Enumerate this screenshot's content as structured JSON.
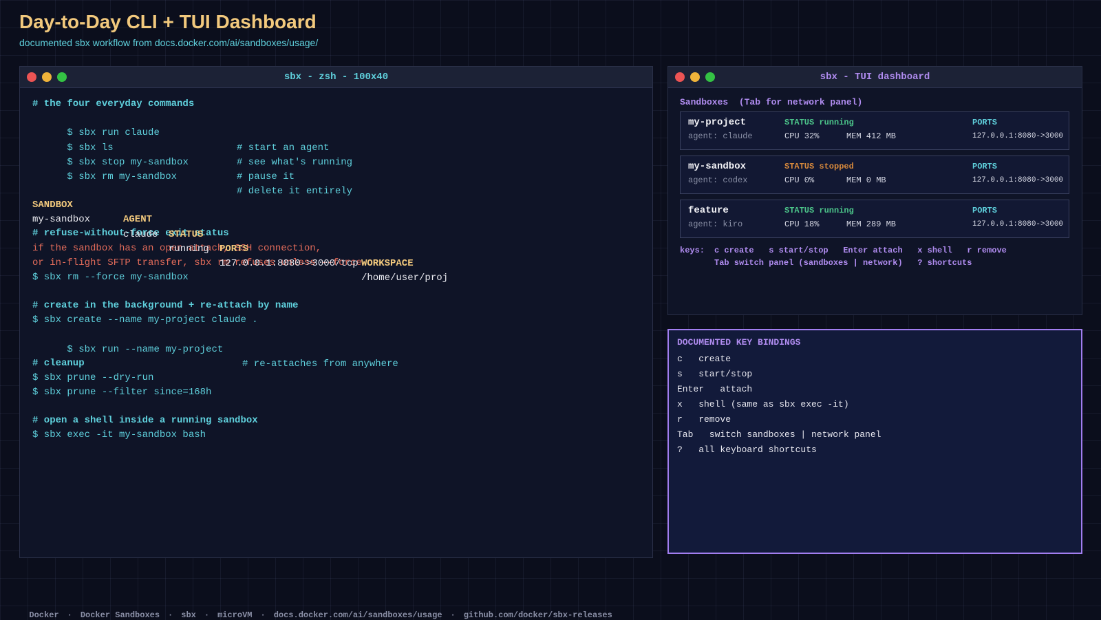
{
  "page": {
    "title": "Day-to-Day CLI + TUI Dashboard",
    "subtitle": "documented sbx workflow from docs.docker.com/ai/sandboxes/usage/"
  },
  "terminal": {
    "title": "sbx  -  zsh  -  100x40",
    "sections": {
      "everyday_comment": "# the four everyday commands",
      "everyday": [
        {
          "cmd": "$ sbx run claude",
          "comment": "# start an agent"
        },
        {
          "cmd": "$ sbx ls",
          "comment": "# see what's running"
        },
        {
          "cmd": "$ sbx stop my-sandbox",
          "comment": "# pause it"
        },
        {
          "cmd": "$ sbx rm my-sandbox",
          "comment": "# delete it entirely"
        }
      ],
      "table": {
        "headers": [
          "SANDBOX",
          "AGENT",
          "STATUS",
          "PORTS",
          "WORKSPACE"
        ],
        "row": [
          "my-sandbox",
          "claude",
          "running",
          "127.0.0.1:8080->3000/tcp",
          "/home/user/proj"
        ]
      },
      "force_comment": "# refuse-without-force exit status",
      "force_error_1": "if the sandbox has an open attach, SSH connection,",
      "force_error_2": "or in-flight SFTP transfer, sbx rm refuses unless --force",
      "force_cmd": "$ sbx rm --force my-sandbox",
      "create_comment": "# create in the background + re-attach by name",
      "create_cmd_1": "$ sbx create --name my-project claude .",
      "create_cmd_2": "$ sbx run --name my-project",
      "create_cmd_2_comment": "# re-attaches from anywhere",
      "cleanup_comment": "# cleanup",
      "cleanup_cmd_1": "$ sbx prune --dry-run",
      "cleanup_cmd_2": "$ sbx prune --filter since=168h",
      "shell_comment": "# open a shell inside a running sandbox",
      "shell_cmd": "$ sbx exec -it my-sandbox bash"
    }
  },
  "tui": {
    "title": "sbx  -  TUI dashboard",
    "header": "Sandboxes  (Tab for network panel)",
    "sandboxes": [
      {
        "name": "my-project",
        "agent": "agent: claude",
        "status": "STATUS running",
        "cpu": "CPU 32%",
        "mem": "MEM 412 MB",
        "ports_label": "PORTS",
        "ports": "127.0.0.1:8080->3000"
      },
      {
        "name": "my-sandbox",
        "agent": "agent: codex",
        "status": "STATUS stopped",
        "cpu": "CPU 0%",
        "mem": "MEM 0 MB",
        "ports_label": "PORTS",
        "ports": "127.0.0.1:8080->3000"
      },
      {
        "name": "feature",
        "agent": "agent: kiro",
        "status": "STATUS running",
        "cpu": "CPU 18%",
        "mem": "MEM 289 MB",
        "ports_label": "PORTS",
        "ports": "127.0.0.1:8080->3000"
      }
    ],
    "keys_label": "keys:",
    "keys_line_1": "c create   s start/stop   Enter attach   x shell   r remove",
    "keys_line_2": "Tab switch panel (sandboxes | network)   ? shortcuts"
  },
  "keybindings": {
    "title": "DOCUMENTED KEY BINDINGS",
    "items": [
      "c   create",
      "s   start/stop",
      "Enter   attach",
      "x   shell (same as sbx exec -it)",
      "r   remove",
      "Tab   switch sandboxes | network panel",
      "?   all keyboard shortcuts"
    ]
  },
  "footer": {
    "items": [
      "Docker",
      "Docker Sandboxes",
      "sbx",
      "microVM",
      "docs.docker.com/ai/sandboxes/usage",
      "github.com/docker/sbx-releases"
    ],
    "separator": "·"
  },
  "colors": {
    "title": "#f2c97d",
    "accent_cyan": "#5fd0dc",
    "accent_purple": "#b08cf0",
    "error": "#e26b5a",
    "running": "#4cc58a",
    "stopped": "#d98a3c"
  }
}
